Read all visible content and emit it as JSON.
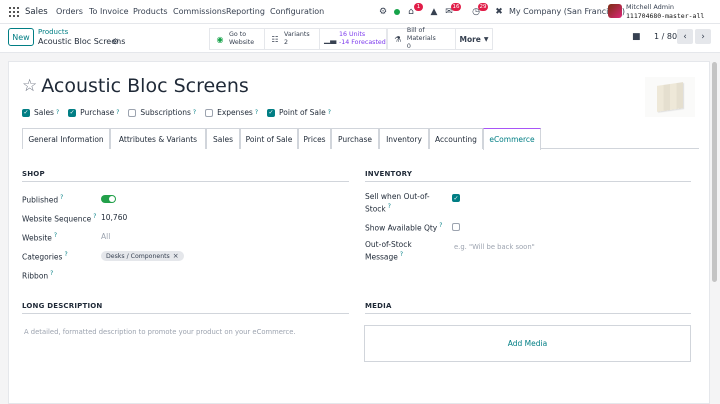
{
  "nav": {
    "brand": "Sales",
    "items": [
      "Orders",
      "To Invoice",
      "Products",
      "Commissions",
      "Reporting",
      "Configuration"
    ],
    "badges": {
      "activity": "1",
      "messages": "16",
      "clock": "29"
    },
    "company": "My Company (San Francisco)",
    "user": "Mitchell Admin",
    "database": "111704680-master-all"
  },
  "control": {
    "new_label": "New",
    "breadcrumb_parent": "Products",
    "breadcrumb_current": "Acoustic Bloc Screens",
    "smart_buttons": {
      "website": {
        "l1": "Go to",
        "l2": "Website"
      },
      "variants": {
        "l1": "Variants",
        "l2": "2"
      },
      "units": {
        "l1": "16 Units",
        "l2": "-14 Forecasted"
      },
      "bom": {
        "l1": "Bill of Materials",
        "l2": "0"
      },
      "more": "More"
    },
    "pager": "1 / 80"
  },
  "form": {
    "title": "Acoustic Bloc Screens",
    "flags": [
      {
        "label": "Sales",
        "checked": true
      },
      {
        "label": "Purchase",
        "checked": true
      },
      {
        "label": "Subscriptions",
        "checked": false
      },
      {
        "label": "Expenses",
        "checked": false
      },
      {
        "label": "Point of Sale",
        "checked": true
      }
    ],
    "tabs": [
      "General Information",
      "Attributes & Variants",
      "Sales",
      "Point of Sale",
      "Prices",
      "Purchase",
      "Inventory",
      "Accounting",
      "eCommerce"
    ],
    "active_tab": "eCommerce",
    "shop": {
      "title": "SHOP",
      "published_label": "Published",
      "published": true,
      "sequence_label": "Website Sequence",
      "sequence_value": "10,760",
      "website_label": "Website",
      "website_placeholder": "All",
      "categories_label": "Categories",
      "category_tag": "Desks / Components",
      "ribbon_label": "Ribbon"
    },
    "inventory": {
      "title": "INVENTORY",
      "sell_oos_l1": "Sell when Out-of-",
      "sell_oos_l2": "Stock",
      "sell_oos": true,
      "show_qty_label": "Show Available Qty",
      "show_qty": false,
      "oos_msg_l1": "Out-of-Stock",
      "oos_msg_l2": "Message",
      "oos_msg_placeholder": "e.g. \"Will be back soon\""
    },
    "long_desc": {
      "title": "LONG DESCRIPTION",
      "placeholder": "A detailed, formatted description to promote your product on your eCommerce."
    },
    "media": {
      "title": "MEDIA",
      "add_label": "Add Media"
    }
  },
  "colors": {
    "accent": "#017e84",
    "toggle_on": "#22a04a",
    "tab_active_border": "#a855f7"
  }
}
